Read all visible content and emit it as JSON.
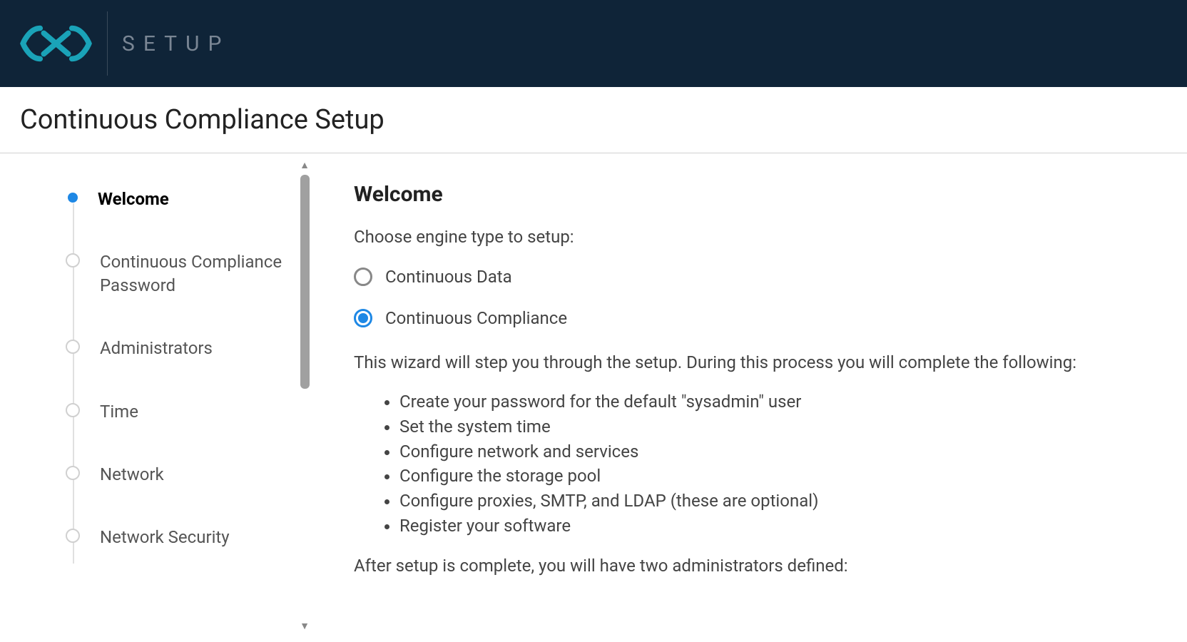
{
  "header": {
    "title": "SETUP"
  },
  "page": {
    "title": "Continuous Compliance Setup"
  },
  "sidebar": {
    "steps": [
      {
        "label": "Welcome",
        "active": true
      },
      {
        "label": "Continuous Compliance Password",
        "active": false
      },
      {
        "label": "Administrators",
        "active": false
      },
      {
        "label": "Time",
        "active": false
      },
      {
        "label": "Network",
        "active": false
      },
      {
        "label": "Network Security",
        "active": false
      }
    ]
  },
  "main": {
    "heading": "Welcome",
    "prompt": "Choose engine type to setup:",
    "options": [
      {
        "label": "Continuous Data",
        "selected": false
      },
      {
        "label": "Continuous Compliance",
        "selected": true
      }
    ],
    "description": "This wizard will step you through the setup. During this process you will complete the following:",
    "bullets": [
      "Create your password for the default \"sysadmin\" user",
      "Set the system time",
      "Configure network and services",
      "Configure the storage pool",
      "Configure proxies, SMTP, and LDAP (these are optional)",
      "Register your software"
    ],
    "after": "After setup is complete, you will have two administrators defined:"
  }
}
